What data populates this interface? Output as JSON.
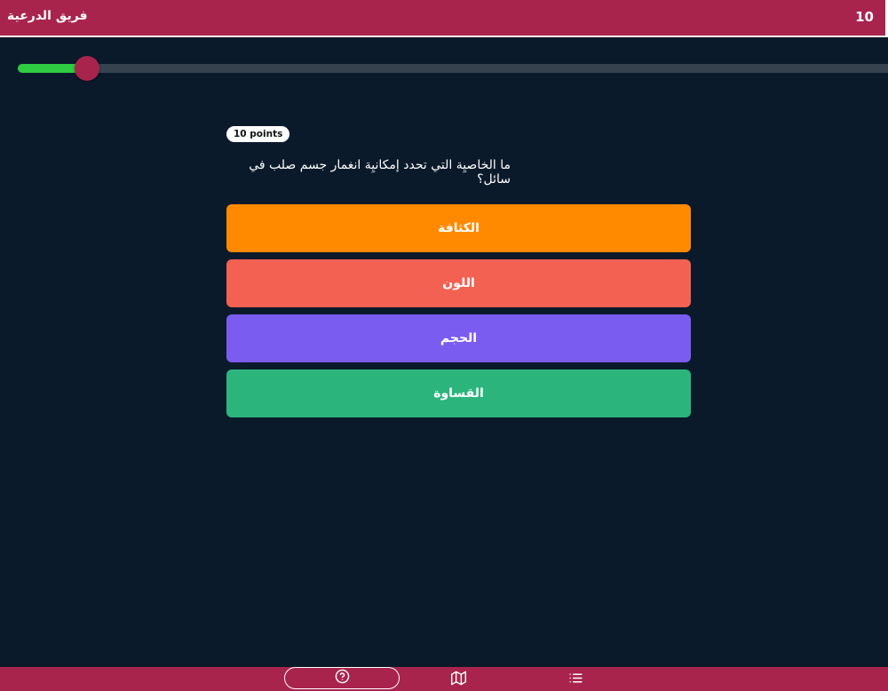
{
  "header": {
    "team_name": "فريق الدرعية",
    "score": "10"
  },
  "progress": {
    "fraction": 0.08
  },
  "question": {
    "points_label": "10 points",
    "text": "ما الخاصيِة التي تحدد إمكانيِة انغمار جسم صلب في سائل؟"
  },
  "answers": [
    {
      "label": "الكثافة",
      "color": "#ff8a00"
    },
    {
      "label": "اللون",
      "color": "#f26152"
    },
    {
      "label": "الحجم",
      "color": "#7b5cf0"
    },
    {
      "label": "القساوة",
      "color": "#2bb57d"
    }
  ],
  "colors": {
    "brand": "#a8244d",
    "background": "#0b1a2b",
    "progress_fill": "#2ecc40",
    "progress_track": "#36434f"
  },
  "bottom_bar": {
    "icons": [
      "help-circle-icon",
      "map-icon",
      "list-icon"
    ]
  }
}
